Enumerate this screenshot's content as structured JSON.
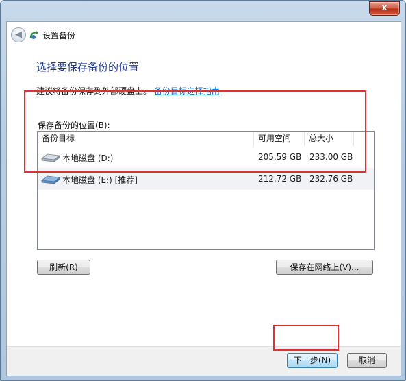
{
  "window": {
    "title": "设置备份",
    "close_label": "x"
  },
  "nav": {
    "back_glyph": "◀"
  },
  "page": {
    "heading": "选择要保存备份的位置",
    "recommend_text": "建议将备份保存到外部硬盘上。",
    "guide_link": "备份目标选择指南"
  },
  "list": {
    "label": "保存备份的位置(B):",
    "columns": [
      "备份目标",
      "可用空间",
      "总大小"
    ],
    "rows": [
      {
        "name": "本地磁盘 (D:)",
        "free": "205.59 GB",
        "total": "233.00 GB",
        "selected": false
      },
      {
        "name": "本地磁盘 (E:) [推荐]",
        "free": "212.72 GB",
        "total": "232.76 GB",
        "selected": true
      }
    ]
  },
  "buttons": {
    "refresh": "刷新(R)",
    "network": "保存在网络上(V)...",
    "next": "下一步(N)",
    "cancel": "取消"
  },
  "colors": {
    "highlight": "#e0302f",
    "heading": "#1f3a93",
    "link": "#0066cc"
  },
  "icons": {
    "back": "back-arrow-icon",
    "app": "backup-icon",
    "drive": "hard-drive-icon",
    "close": "close-icon"
  }
}
